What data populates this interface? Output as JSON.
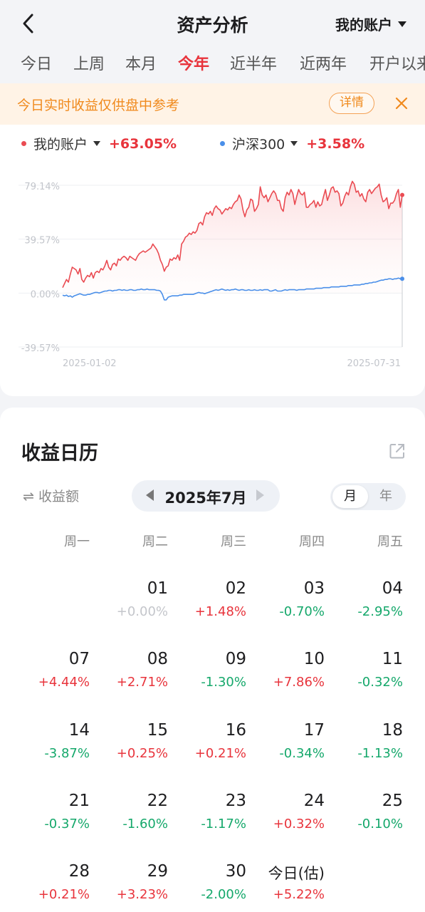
{
  "header": {
    "title": "资产分析",
    "account_label": "我的账户"
  },
  "tabs": [
    {
      "label": "今日",
      "active": false
    },
    {
      "label": "上周",
      "active": false
    },
    {
      "label": "本月",
      "active": false
    },
    {
      "label": "今年",
      "active": true
    },
    {
      "label": "近半年",
      "active": false
    },
    {
      "label": "近两年",
      "active": false
    },
    {
      "label": "开户以来",
      "active": false
    }
  ],
  "banner": {
    "text": "今日实时收益仅供盘中参考",
    "detail_label": "详情"
  },
  "legend": {
    "account": {
      "name": "我的账户",
      "value": "+63.05%"
    },
    "benchmark": {
      "name": "沪深300",
      "value": "+3.58%"
    }
  },
  "colors": {
    "account_line": "#ea4b52",
    "benchmark_line": "#4a8fe9",
    "positive": "#e8343c",
    "negative": "#15a86b",
    "accent_orange": "#f08a1d"
  },
  "chart_data": {
    "type": "line",
    "y_ticks": [
      "79.14%",
      "39.57%",
      "0.00%",
      "-39.57%"
    ],
    "ylim": [
      -39.57,
      79.14
    ],
    "x_labels": [
      "2025-01-02",
      "2025-07-31"
    ],
    "grid": true,
    "series": [
      {
        "name": "我的账户",
        "color": "#ea4b52",
        "values": [
          4,
          7,
          10,
          8,
          14,
          19,
          18,
          17,
          14,
          18,
          10,
          8,
          11,
          13,
          12,
          15,
          11,
          15,
          16,
          15,
          18,
          17,
          20,
          24,
          19,
          17,
          21,
          22,
          20,
          25,
          24,
          26,
          27,
          26,
          24,
          27,
          26,
          25,
          24,
          27,
          29,
          30,
          31,
          30,
          31,
          32,
          33,
          36,
          34,
          32,
          29,
          24,
          21,
          16,
          19,
          20,
          25,
          24,
          26,
          25,
          28,
          24,
          36,
          38,
          41,
          42,
          44,
          43,
          45,
          44,
          46,
          51,
          52,
          50,
          56,
          59,
          58,
          60,
          57,
          62,
          64,
          62,
          61,
          58,
          60,
          62,
          61,
          63,
          62,
          65,
          67,
          68,
          72,
          69,
          61,
          56,
          61,
          63,
          69,
          68,
          60,
          62,
          65,
          78,
          72,
          70,
          72,
          67,
          70,
          73,
          75,
          73,
          68,
          68,
          62,
          60,
          70,
          74,
          72,
          76,
          73,
          65,
          71,
          76,
          73,
          72,
          74,
          63,
          63,
          65,
          66,
          68,
          63,
          67,
          64,
          65,
          71,
          76,
          68,
          72,
          77,
          78,
          74,
          75,
          73,
          64,
          66,
          71,
          74,
          72,
          78,
          82,
          80,
          74,
          75,
          71,
          73,
          69,
          67,
          74,
          76,
          73,
          75,
          77,
          78,
          80,
          72,
          67,
          68,
          70,
          62,
          66,
          66,
          68,
          73,
          76,
          63,
          72
        ]
      },
      {
        "name": "沪深300",
        "color": "#4a8fe9",
        "values": [
          -1.5,
          -2,
          -1.5,
          -2.5,
          -2,
          -3,
          -2,
          -1.5,
          -1,
          -0.5,
          -1,
          -1.5,
          -1.5,
          -1,
          -1,
          -0.5,
          0,
          0.5,
          0.5,
          0,
          0.5,
          1,
          1.5,
          1.5,
          2,
          2,
          1.5,
          2,
          2,
          2.5,
          2.5,
          2,
          2.5,
          2,
          2,
          2.5,
          2.5,
          2,
          2,
          2.5,
          2.5,
          3,
          2.5,
          2.5,
          3,
          2.5,
          2.5,
          2.5,
          2.5,
          2,
          2,
          1.5,
          -1,
          -5,
          -5,
          -3,
          -2.5,
          -2,
          -2,
          -2,
          -2,
          -1.5,
          -1.5,
          -1,
          -1,
          -1,
          -1,
          -1,
          -1,
          -0.5,
          0,
          0.5,
          0,
          0,
          -0.5,
          0,
          0.5,
          1,
          1.5,
          2,
          2.5,
          2,
          2.5,
          3,
          2.5,
          2,
          2.5,
          2,
          2.5,
          2.5,
          3,
          2.5,
          2,
          2.5,
          2.5,
          2,
          2,
          2.5,
          2,
          2,
          2.5,
          2,
          2,
          2.5,
          2,
          2.5,
          2.5,
          2.5,
          1.5,
          1.5,
          2,
          2.5,
          1.5,
          1.5,
          1.5,
          2,
          2.5,
          2,
          2.5,
          2.5,
          2.5,
          2.5,
          2,
          2.5,
          2.5,
          2.5,
          2.5,
          3,
          3,
          3,
          3,
          3,
          3.5,
          3.5,
          3.5,
          3.5,
          4,
          4,
          4,
          4,
          4.5,
          4.5,
          4.5,
          4.5,
          4.5,
          5,
          5,
          5,
          5,
          5.5,
          5.5,
          5.5,
          6,
          6,
          6,
          6,
          6.5,
          6.5,
          7,
          7,
          7.5,
          7.5,
          8,
          8,
          8.5,
          9,
          9.5,
          9.5,
          10,
          10,
          10.5,
          10.5,
          10,
          10.5,
          10.5,
          11,
          10.5,
          10.5
        ]
      }
    ]
  },
  "calendar": {
    "title": "收益日历",
    "metric_label": "⇌ 收益额",
    "month_label": "2025年7月",
    "period_options": [
      {
        "label": "月",
        "active": true
      },
      {
        "label": "年",
        "active": false
      }
    ],
    "weekdays": [
      "周一",
      "周二",
      "周三",
      "周四",
      "周五"
    ],
    "weeks": [
      [
        null,
        {
          "day": "01",
          "value": "+0.00%",
          "sign": "zero"
        },
        {
          "day": "02",
          "value": "+1.48%",
          "sign": "pos"
        },
        {
          "day": "03",
          "value": "-0.70%",
          "sign": "neg"
        },
        {
          "day": "04",
          "value": "-2.95%",
          "sign": "neg"
        }
      ],
      [
        {
          "day": "07",
          "value": "+4.44%",
          "sign": "pos"
        },
        {
          "day": "08",
          "value": "+2.71%",
          "sign": "pos"
        },
        {
          "day": "09",
          "value": "-1.30%",
          "sign": "neg"
        },
        {
          "day": "10",
          "value": "+7.86%",
          "sign": "pos"
        },
        {
          "day": "11",
          "value": "-0.32%",
          "sign": "neg"
        }
      ],
      [
        {
          "day": "14",
          "value": "-3.87%",
          "sign": "neg"
        },
        {
          "day": "15",
          "value": "+0.25%",
          "sign": "pos"
        },
        {
          "day": "16",
          "value": "+0.21%",
          "sign": "pos"
        },
        {
          "day": "17",
          "value": "-0.34%",
          "sign": "neg"
        },
        {
          "day": "18",
          "value": "-1.13%",
          "sign": "neg"
        }
      ],
      [
        {
          "day": "21",
          "value": "-0.37%",
          "sign": "neg"
        },
        {
          "day": "22",
          "value": "-1.60%",
          "sign": "neg"
        },
        {
          "day": "23",
          "value": "-1.17%",
          "sign": "neg"
        },
        {
          "day": "24",
          "value": "+0.32%",
          "sign": "pos"
        },
        {
          "day": "25",
          "value": "-0.10%",
          "sign": "neg"
        }
      ],
      [
        {
          "day": "28",
          "value": "+0.21%",
          "sign": "pos"
        },
        {
          "day": "29",
          "value": "+3.23%",
          "sign": "pos"
        },
        {
          "day": "30",
          "value": "-2.00%",
          "sign": "neg"
        },
        {
          "day": "今日(估)",
          "value": "+5.22%",
          "sign": "pos",
          "today": true
        },
        null
      ]
    ]
  }
}
